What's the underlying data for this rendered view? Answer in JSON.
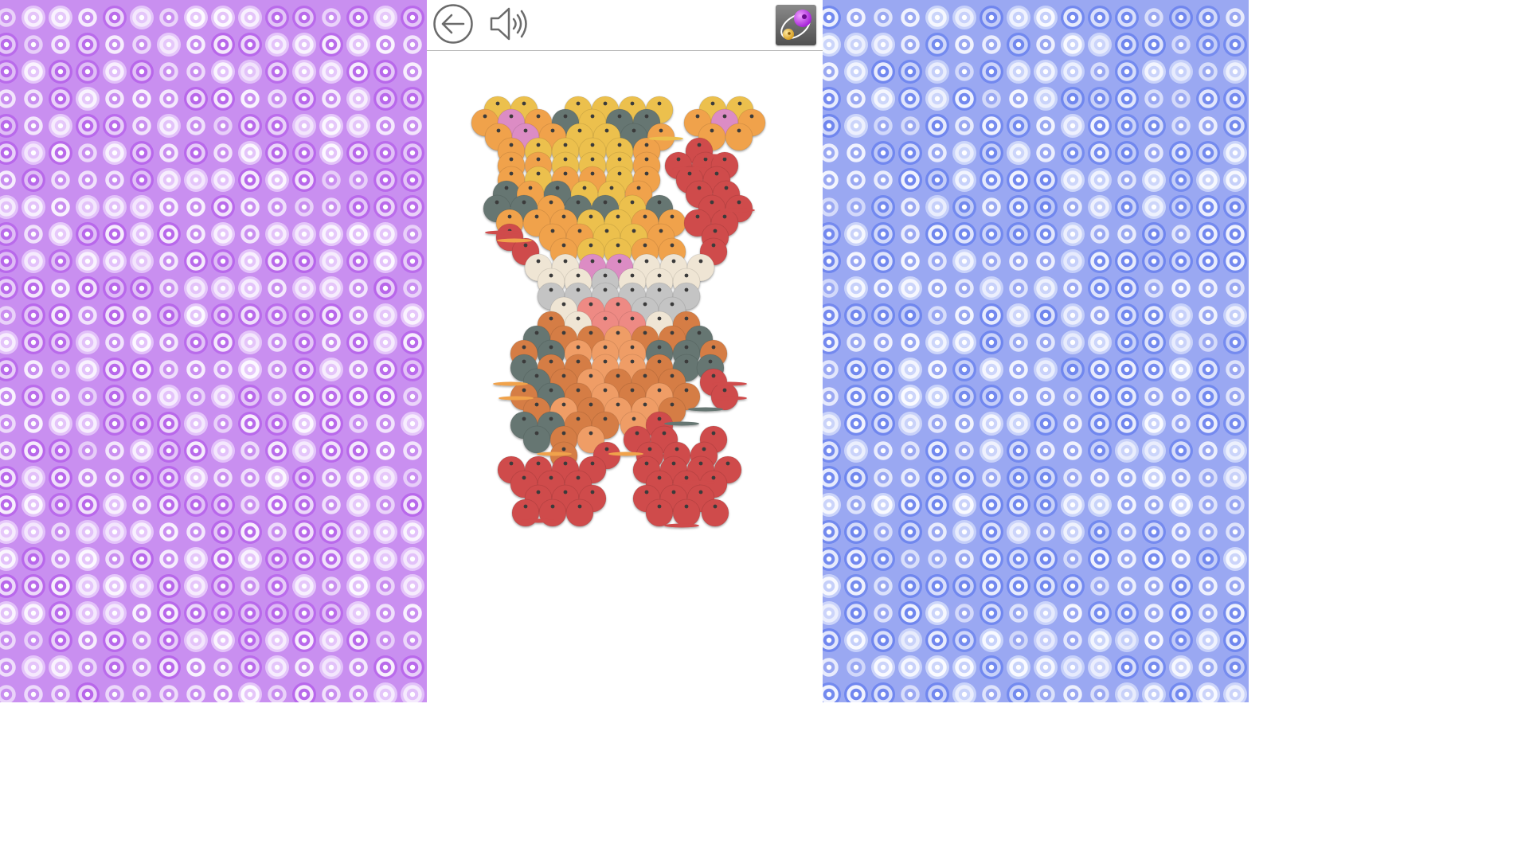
{
  "toolbar": {
    "back": {
      "icon": "back-arrow-icon"
    },
    "sound": {
      "icon": "speaker-icon",
      "state": "on"
    },
    "theme": {
      "icon": "sequin-theme-icon"
    }
  },
  "backgrounds": {
    "left": {
      "pattern": "sequin-pattern",
      "base": "#c98ff0",
      "light": "#e6c9fa",
      "dark": "#b766ea"
    },
    "right": {
      "pattern": "sequin-pattern",
      "base": "#9aa8f2",
      "light": "#cdd6fa",
      "dark": "#6f86ee"
    }
  },
  "artwork": {
    "subject": "sequin-cat-figure",
    "palette": {
      "yellow": "#ecc04e",
      "orange": "#f0a24c",
      "slate": "#667672",
      "pink": "#dc8cc4",
      "red": "#cf4b4b",
      "cream": "#efe5d4",
      "silver": "#c4c4c4",
      "salmon": "#ee8a84",
      "brown": "#d57d45",
      "peach": "#ef9d66"
    }
  }
}
